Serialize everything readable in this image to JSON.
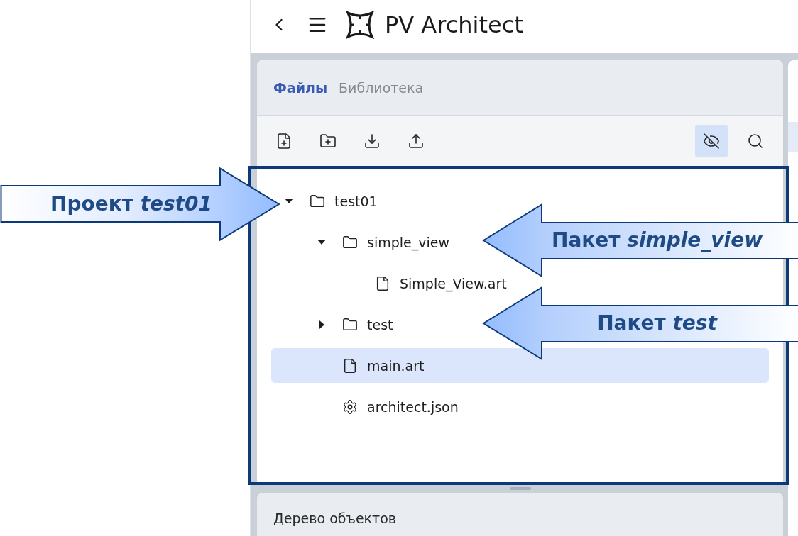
{
  "app_header": {
    "title": "PV Architect"
  },
  "files_panel": {
    "tabs": [
      {
        "label": "Файлы",
        "selected": true
      },
      {
        "label": "Библиотека",
        "selected": false
      }
    ],
    "toolbar": {
      "hidden_items_toggle": {
        "on": true
      }
    },
    "tree": [
      {
        "name": "test01",
        "kind": "folder",
        "expanded": true,
        "selected": false,
        "children": [
          {
            "name": "simple_view",
            "kind": "folder",
            "expanded": true,
            "selected": false,
            "children": [
              {
                "name": "Simple_View.art",
                "kind": "file",
                "selected": false
              }
            ]
          },
          {
            "name": "test",
            "kind": "folder",
            "expanded": false,
            "selected": false
          },
          {
            "name": "main.art",
            "kind": "file",
            "selected": true
          },
          {
            "name": "architect.json",
            "kind": "config",
            "selected": false
          }
        ]
      }
    ]
  },
  "object_tree_panel": {
    "title": "Дерево объектов"
  },
  "annotations": [
    {
      "text": "Проект *test01*",
      "kind": "rightward"
    },
    {
      "text": "Пакет *simple_view*",
      "kind": "leftward"
    },
    {
      "text": "Пакет *test*",
      "kind": "leftward"
    }
  ]
}
